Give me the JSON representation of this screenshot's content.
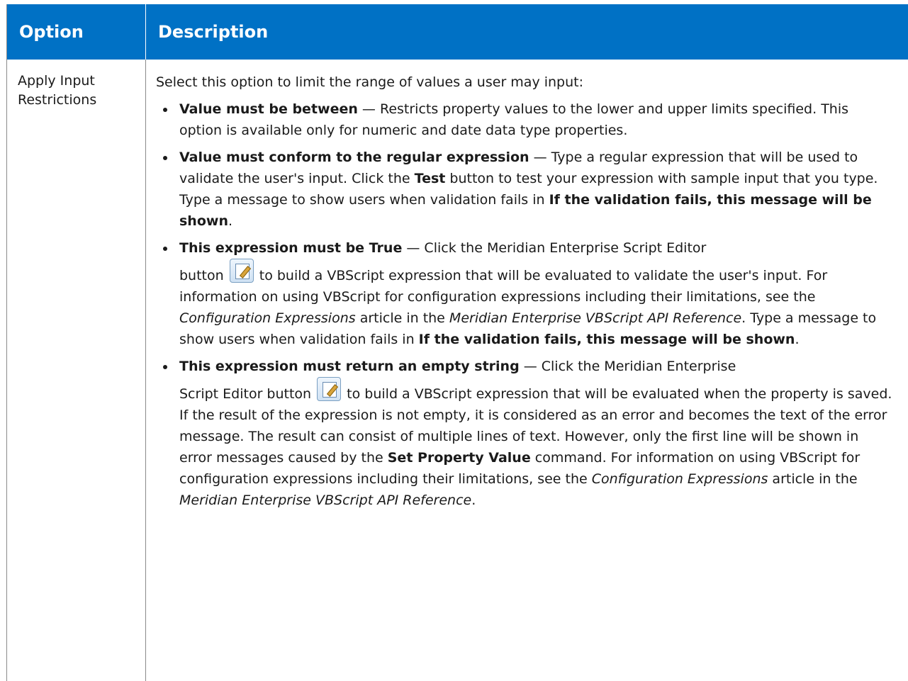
{
  "table": {
    "header": {
      "option": "Option",
      "description": "Description"
    },
    "row": {
      "option_line1": "Apply Input",
      "option_line2": "Restrictions",
      "intro": "Select this option to limit the range of values a user may input:",
      "items": [
        {
          "title": "Value must be between",
          "text": " — Restricts property values to the lower and upper limits specified. This option is available only for numeric and date data type properties."
        },
        {
          "title": "Value must conform to the regular expression",
          "text_a": " — Type a regular expression that will be used to validate the user's input. Click the ",
          "bold_test": "Test",
          "text_b": " button to test your expression with sample input that you type. Type a message to show users when validation fails in ",
          "bold_msg": "If the validation fails, this message will be shown",
          "text_c": "."
        },
        {
          "title": "This expression must be True",
          "text_a": " — Click the Meridian Enterprise Script Editor",
          "text_b": "button ",
          "text_c": " to build a VBScript expression that will be evaluated to validate the user's input.  For information on using VBScript for configuration expressions including their limitations, see the ",
          "italic_1": "Configuration Expressions",
          "text_d": " article in the ",
          "italic_2": "Meridian Enterprise VBScript API Reference",
          "text_e": ". Type a message to show users when validation fails in ",
          "bold_msg": "If the validation fails, this message will be shown",
          "text_f": "."
        },
        {
          "title": "This expression must return an empty string",
          "text_a": " — Click the Meridian Enterprise",
          "text_b": "Script Editor button ",
          "text_c": " to build a VBScript expression that will be evaluated when the property is saved. If the result of the expression is not empty, it is considered as an error and becomes the text of the error message. The result can consist of multiple lines of text. However, only the first line will be shown in error messages caused by the ",
          "bold_cmd": "Set Property Value",
          "text_d": " command.  For information on using VBScript for configuration expressions including their limitations, see the ",
          "italic_1": "Configuration Expressions",
          "text_e": " article in the ",
          "italic_2": "Meridian Enterprise VBScript API Reference",
          "text_f": "."
        }
      ]
    }
  },
  "icons": {
    "script_editor": "script-editor-icon"
  },
  "colors": {
    "header_bg": "#0071c5",
    "header_text": "#ffffff"
  }
}
